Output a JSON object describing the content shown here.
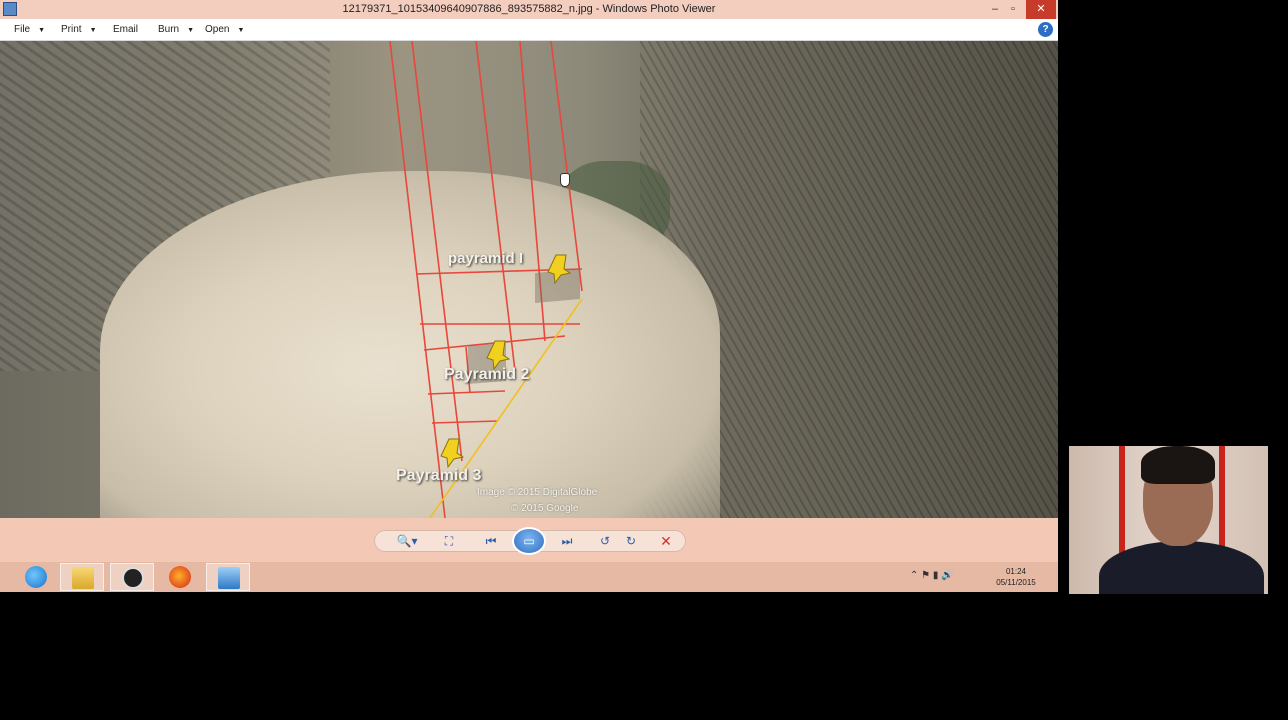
{
  "window": {
    "title": "12179371_10153409640907886_893575882_n.jpg - Windows Photo Viewer",
    "controls": {
      "minimize": "–",
      "maximize": "▫",
      "close": "✕"
    }
  },
  "menu": {
    "items": [
      "File",
      "Print",
      "Email",
      "Burn",
      "Open"
    ],
    "help": "?"
  },
  "photo": {
    "labels": {
      "pyramid1": "payramid I",
      "pyramid2": "Payramid 2",
      "pyramid3": "Payramid 3"
    },
    "credits": [
      "Image © 2015 DigitalGlobe",
      "© 2015 Google"
    ]
  },
  "toolbar": {
    "zoom": "🔍▾",
    "fit": "⛶",
    "prev": "⏮",
    "play": "▭",
    "next": "⏭",
    "rotate_ccw": "↺",
    "rotate_cw": "↻",
    "delete": "✕"
  },
  "taskbar": {
    "apps": [
      "Internet Explorer",
      "File Explorer",
      "OBS",
      "Firefox",
      "Windows Photo Viewer"
    ],
    "tray": "⌃ ⚑ ▮ 🔊",
    "time": "01:24",
    "date": "05/11/2015"
  },
  "colors": {
    "title_bar": "#f3cdbd",
    "route_lines": "#e8473b",
    "axis_line": "#f0c020",
    "pin": "#f2d020",
    "close_button": "#c73b2b"
  }
}
